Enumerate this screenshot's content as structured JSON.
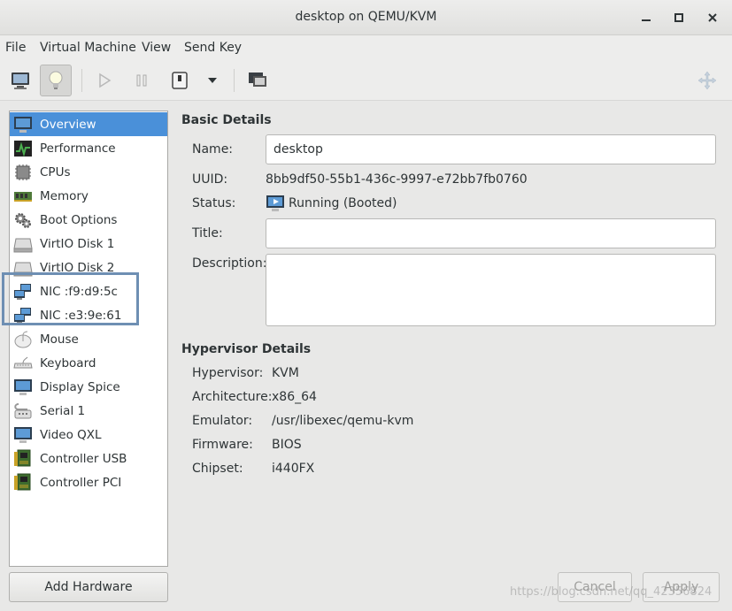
{
  "window": {
    "title": "desktop on QEMU/KVM"
  },
  "menu": [
    "File",
    "Virtual Machine",
    "View",
    "Send Key"
  ],
  "sidebar": {
    "items": [
      {
        "label": "Overview",
        "icon": "monitor-icon"
      },
      {
        "label": "Performance",
        "icon": "performance-graph-icon"
      },
      {
        "label": "CPUs",
        "icon": "cpu-chip-icon"
      },
      {
        "label": "Memory",
        "icon": "memory-stick-icon"
      },
      {
        "label": "Boot Options",
        "icon": "gears-icon"
      },
      {
        "label": "VirtIO Disk 1",
        "icon": "disk-drive-icon"
      },
      {
        "label": "VirtIO Disk 2",
        "icon": "disk-drive-icon"
      },
      {
        "label": "NIC :f9:d9:5c",
        "icon": "network-icon"
      },
      {
        "label": "NIC :e3:9e:61",
        "icon": "network-icon"
      },
      {
        "label": "Mouse",
        "icon": "mouse-icon"
      },
      {
        "label": "Keyboard",
        "icon": "keyboard-icon"
      },
      {
        "label": "Display Spice",
        "icon": "display-icon"
      },
      {
        "label": "Serial 1",
        "icon": "serial-port-icon"
      },
      {
        "label": "Video QXL",
        "icon": "video-card-icon"
      },
      {
        "label": "Controller USB",
        "icon": "controller-card-icon"
      },
      {
        "label": "Controller PCI",
        "icon": "controller-card-icon"
      }
    ],
    "selected_index": 0,
    "add_hardware": "Add Hardware"
  },
  "basic": {
    "heading": "Basic Details",
    "name_label": "Name:",
    "name_value": "desktop",
    "uuid_label": "UUID:",
    "uuid_value": "8bb9df50-55b1-436c-9997-e72bb7fb0760",
    "status_label": "Status:",
    "status_value": "Running (Booted)",
    "title_label": "Title:",
    "title_value": "",
    "description_label": "Description:",
    "description_value": ""
  },
  "hypervisor": {
    "heading": "Hypervisor Details",
    "rows": [
      {
        "label": "Hypervisor:",
        "value": "KVM"
      },
      {
        "label": "Architecture:",
        "value": "x86_64"
      },
      {
        "label": "Emulator:",
        "value": "/usr/libexec/qemu-kvm"
      },
      {
        "label": "Firmware:",
        "value": "BIOS"
      },
      {
        "label": "Chipset:",
        "value": "i440FX"
      }
    ]
  },
  "buttons": {
    "cancel": "Cancel",
    "apply": "Apply"
  },
  "watermark": "https://blog.csdn.net/qq_42356824",
  "colors": {
    "selection": "#4a90d9",
    "highlight_box": "#6e8fb3"
  }
}
